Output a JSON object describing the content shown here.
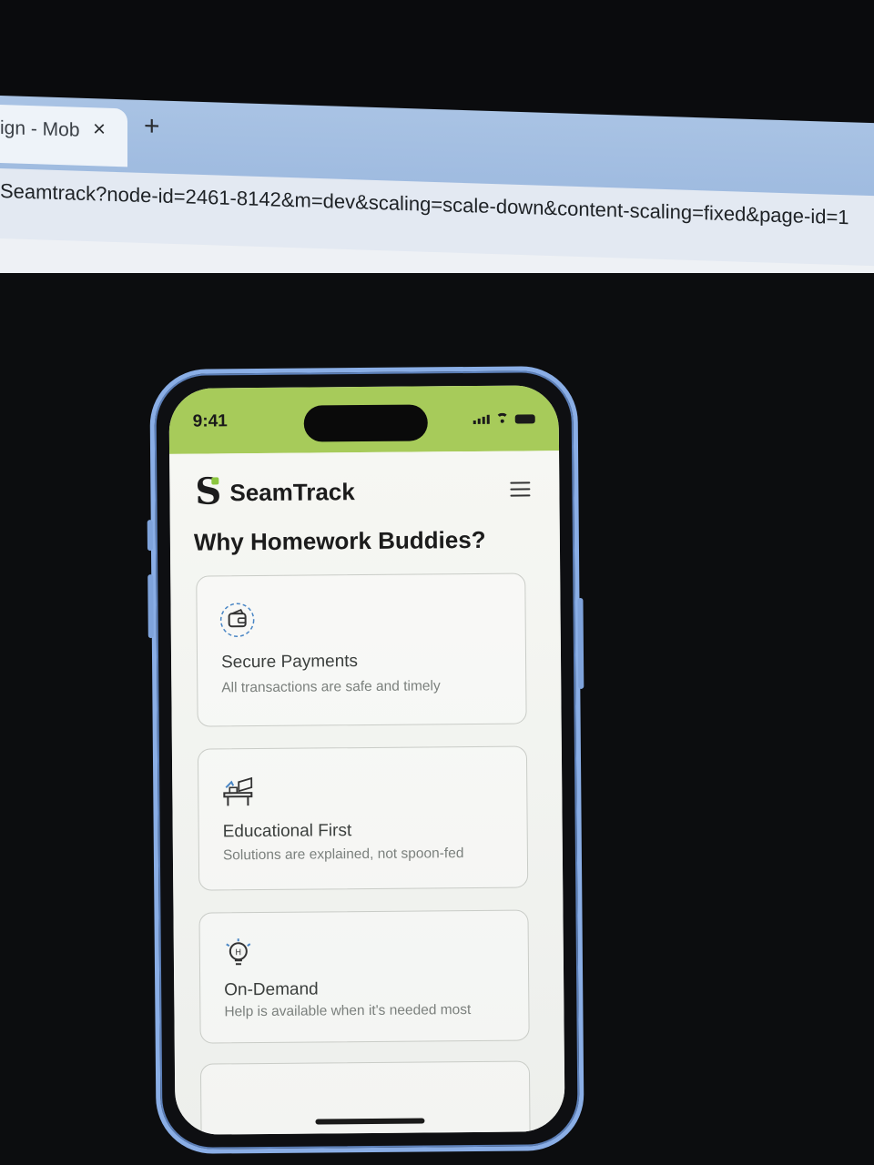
{
  "browser": {
    "tab_title": "ign - Mob",
    "tab_close": "×",
    "new_tab": "+",
    "url": "Seamtrack?node-id=2461-8142&m=dev&scaling=scale-down&content-scaling=fixed&page-id=1"
  },
  "phone": {
    "status_time": "9:41",
    "brand": "SeamTrack",
    "logo_letter": "S",
    "section_title": "Why Homework Buddies?",
    "cards": [
      {
        "title": "Secure Payments",
        "description": "All transactions are safe and timely",
        "icon": "wallet-icon"
      },
      {
        "title": "Educational First",
        "description": "Solutions are explained, not spoon-fed",
        "icon": "desk-study-icon"
      },
      {
        "title": "On-Demand",
        "description": "Help is available when it's needed most",
        "icon": "lightbulb-icon"
      }
    ]
  },
  "colors": {
    "status_bar": "#a7cb5a",
    "accent_green": "#8cc63f",
    "phone_frame": "#8aaee6",
    "browser_tabbar": "#a9c3e4"
  }
}
